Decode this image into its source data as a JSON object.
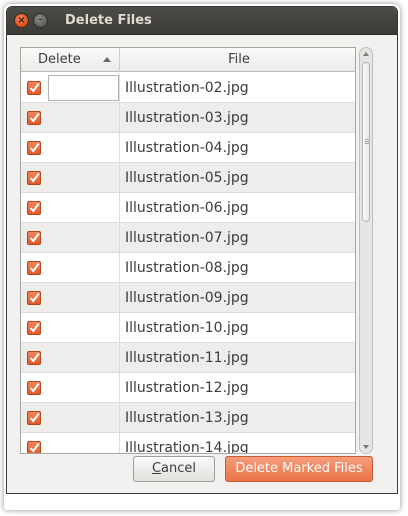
{
  "window": {
    "title": "Delete Files",
    "close_glyph": "×",
    "minimize_glyph": "–"
  },
  "table": {
    "columns": {
      "delete": "Delete",
      "file": "File"
    },
    "sort_icon": "sort-ascending-icon",
    "rows": [
      {
        "checked": true,
        "file": "Illustration-02.jpg"
      },
      {
        "checked": true,
        "file": "Illustration-03.jpg"
      },
      {
        "checked": true,
        "file": "Illustration-04.jpg"
      },
      {
        "checked": true,
        "file": "Illustration-05.jpg"
      },
      {
        "checked": true,
        "file": "Illustration-06.jpg"
      },
      {
        "checked": true,
        "file": "Illustration-07.jpg"
      },
      {
        "checked": true,
        "file": "Illustration-08.jpg"
      },
      {
        "checked": true,
        "file": "Illustration-09.jpg"
      },
      {
        "checked": true,
        "file": "Illustration-10.jpg"
      },
      {
        "checked": true,
        "file": "Illustration-11.jpg"
      },
      {
        "checked": true,
        "file": "Illustration-12.jpg"
      },
      {
        "checked": true,
        "file": "Illustration-13.jpg"
      },
      {
        "checked": true,
        "file": "Illustration-14.jpg"
      }
    ]
  },
  "buttons": {
    "cancel_mnemonic": "C",
    "cancel_rest": "ancel",
    "delete": "Delete Marked Files"
  },
  "colors": {
    "accent": "#e9683a",
    "titlebar": "#3c3b37",
    "checkbox": "#df5a2b"
  }
}
